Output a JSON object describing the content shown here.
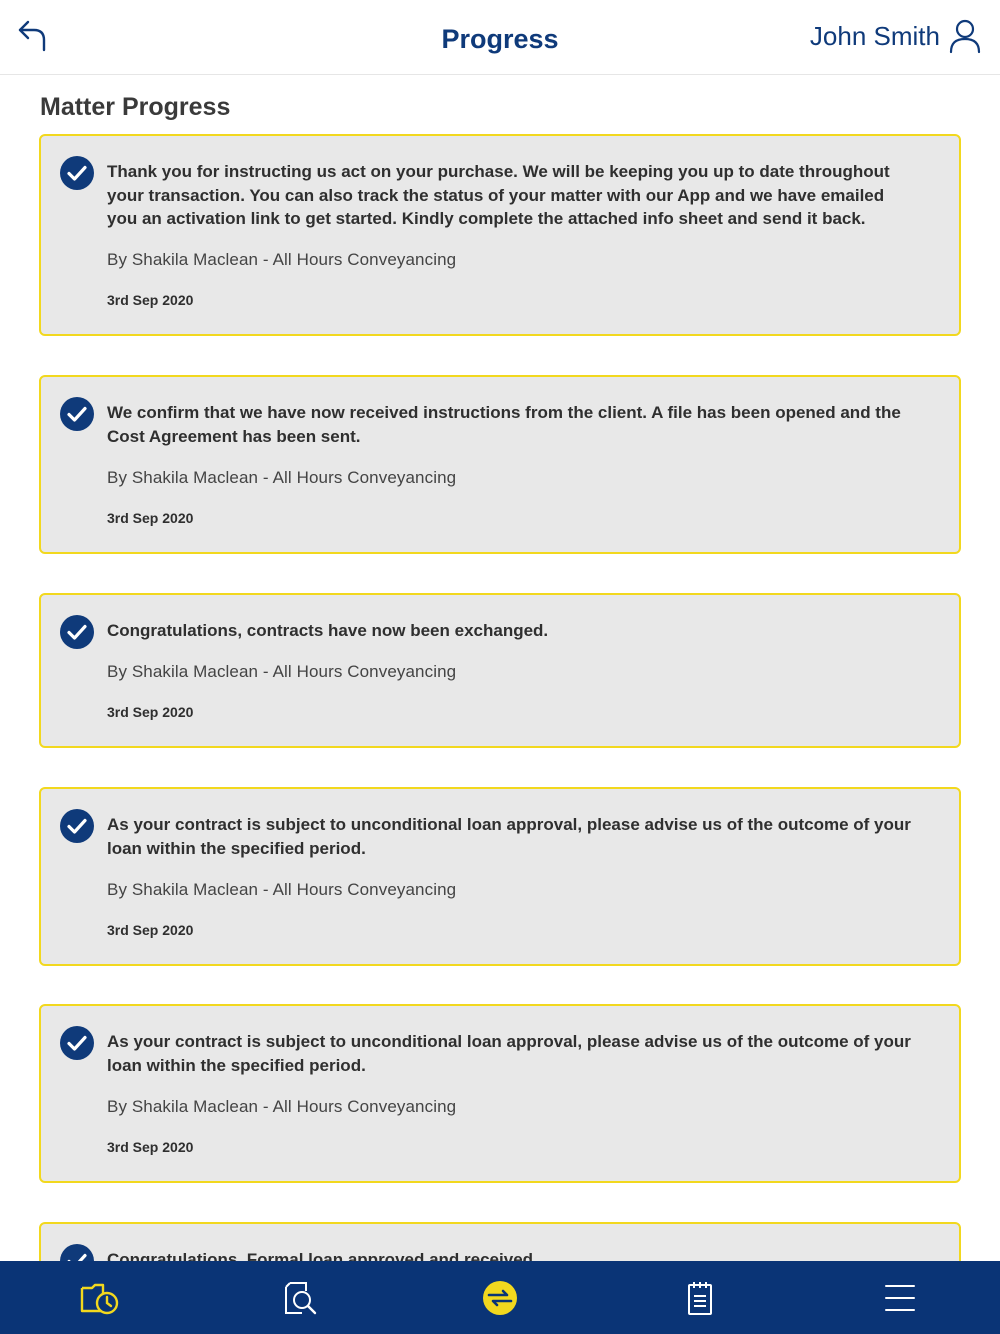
{
  "header": {
    "title": "Progress",
    "user_name": "John Smith"
  },
  "section": {
    "title": "Matter Progress"
  },
  "cards": [
    {
      "text": "Thank you for instructing us act on your purchase. We will be keeping you up to date throughout your transaction. You can also track the status of your matter with our App and we have emailed you an activation link to get started. Kindly complete the attached info sheet and send it back.",
      "by": "By Shakila Maclean - All Hours Conveyancing",
      "date": "3rd Sep 2020"
    },
    {
      "text": "We confirm that we have now received instructions from the client. A file has been opened and the Cost Agreement has been sent.",
      "by": "By Shakila Maclean - All Hours Conveyancing",
      "date": "3rd Sep 2020"
    },
    {
      "text": "Congratulations, contracts have now been exchanged.",
      "by": "By Shakila Maclean - All Hours Conveyancing",
      "date": "3rd Sep 2020"
    },
    {
      "text": "As your contract is subject to unconditional loan approval, please advise us of the outcome of your loan within the specified period.",
      "by": "By Shakila Maclean - All Hours Conveyancing",
      "date": "3rd Sep 2020"
    },
    {
      "text": "As your contract is subject to unconditional loan approval, please advise us of the outcome of your loan within the specified period.",
      "by": "By Shakila Maclean - All Hours Conveyancing",
      "date": "3rd Sep 2020"
    },
    {
      "text": "Congratulations, Formal loan approved and received."
    }
  ],
  "tabbar": {
    "items": [
      "progress-tab-icon",
      "documents-search-tab-icon",
      "exchange-tab-icon",
      "notes-tab-icon",
      "menu-tab-icon"
    ],
    "active_index": 0
  },
  "colors": {
    "brand_blue": "#0f3a7a",
    "tabbar_bg": "#0a3476",
    "accent_yellow": "#f2d81e",
    "card_bg": "#e8e8e8"
  }
}
